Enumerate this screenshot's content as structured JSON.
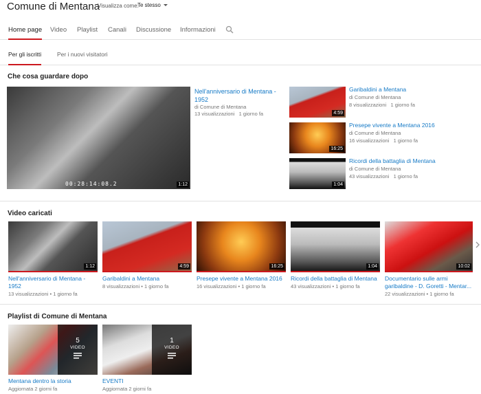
{
  "header": {
    "channel_title": "Comune di Mentana",
    "view_as_label": "Visualizza come:",
    "view_as_value": "Te stesso"
  },
  "tabs": [
    "Home page",
    "Video",
    "Playlist",
    "Canali",
    "Discussione",
    "Informazioni"
  ],
  "subtabs": [
    "Per gli iscritti",
    "Per i nuovi visitatori"
  ],
  "watch_next": {
    "section_title": "Che cosa guardare dopo",
    "featured": {
      "title": "Nell'anniversario di Mentana - 1952",
      "channel": "di Comune di Mentana",
      "views": "13 visualizzazioni",
      "age": "1 giorno fa",
      "duration": "1:12",
      "timecode": "00:28:14:08.2"
    },
    "side": [
      {
        "title": "Garibaldini a Mentana",
        "channel": "di Comune di Mentana",
        "views": "8 visualizzazioni",
        "age": "1 giorno fa",
        "duration": "4:59"
      },
      {
        "title": "Presepe vivente a Mentana 2016",
        "channel": "di Comune di Mentana",
        "views": "16 visualizzazioni",
        "age": "1 giorno fa",
        "duration": "16:25"
      },
      {
        "title": "Ricordi della battaglia di Mentana",
        "channel": "di Comune di Mentana",
        "views": "43 visualizzazioni",
        "age": "1 giorno fa",
        "duration": "1:04"
      }
    ]
  },
  "uploads": {
    "section_title": "Video caricati",
    "items": [
      {
        "title": "Nell'anniversario di Mentana - 1952",
        "views": "13 visualizzazioni",
        "age": "1 giorno fa",
        "duration": "1:12"
      },
      {
        "title": "Garibaldini a Mentana",
        "views": "8 visualizzazioni",
        "age": "1 giorno fa",
        "duration": "4:59"
      },
      {
        "title": "Presepe vivente a Mentana 2016",
        "views": "16 visualizzazioni",
        "age": "1 giorno fa",
        "duration": "16:25"
      },
      {
        "title": "Ricordi della battaglia di Mentana",
        "views": "43 visualizzazioni",
        "age": "1 giorno fa",
        "duration": "1:04"
      },
      {
        "title_line1": "Documentario sulle armi",
        "title_line2": "garibaldine - D. Goretti - Mentar...",
        "views": "22 visualizzazioni",
        "age": "1 giorno fa",
        "duration": "10:02"
      }
    ],
    "separator": "•"
  },
  "playlists": {
    "section_title": "Playlist di Comune di Mentana",
    "items": [
      {
        "title": "Mentana dentro la storia",
        "updated": "Aggiornata 2 giorni fa",
        "count": "5",
        "video_label": "VIDEO"
      },
      {
        "title": "EVENTI",
        "updated": "Aggiornata 2 giorni fa",
        "count": "1",
        "video_label": "VIDEO"
      }
    ]
  },
  "icons": {
    "search": "search-icon",
    "next": "chevron-right-icon",
    "playlist": "playlist-lines-icon",
    "caret": "caret-down-icon"
  },
  "colors": {
    "accent": "#cc181e",
    "link": "#167ac6"
  }
}
